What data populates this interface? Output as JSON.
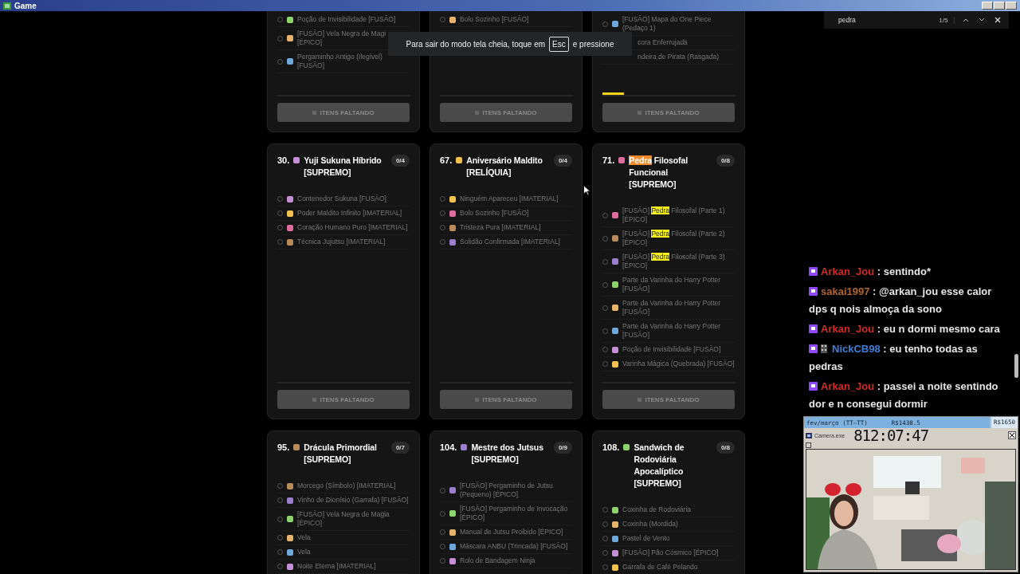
{
  "window": {
    "title": "Game"
  },
  "fullscreen_notice": {
    "before": "Para sair do modo tela cheia, toque em",
    "key": "Esc",
    "after": "e pressione"
  },
  "find_bar": {
    "value": "pedra",
    "count": "1/5"
  },
  "cards": [
    {
      "items": [
        {
          "text": "Poção de Invisibilidade [FUSÃO]",
          "checked": false
        },
        {
          "text": "[FUSÃO] Vela Negra de Magi [ÉPICO]",
          "checked": false
        },
        {
          "text": "Pergaminho Antigo (Ilegível) [FUSÃO]",
          "checked": false
        }
      ],
      "button": "ITENS FALTANDO"
    },
    {
      "items": [
        {
          "text": "Bolo Sozinho [FUSÃO]",
          "checked": false
        }
      ],
      "button": "ITENS FALTANDO"
    },
    {
      "items": [
        {
          "text": "[FUSÃO] Mapa do One Piece (Pedaço 1)",
          "checked": false
        },
        {
          "text": "cora Enferrujada",
          "kind": "partial"
        },
        {
          "text": "ndeira de Pirata (Rasgada)",
          "kind": "partial"
        }
      ],
      "level": 0.16,
      "button": "ITENS FALTANDO"
    },
    {
      "number": "30.",
      "title": [
        {
          "text": "Yuji Sukuna Híbrido [SUPREMO]",
          "highlighted": false,
          "current": false
        }
      ],
      "count": "0/4",
      "items": [
        {
          "text": "Contenedor Sukuna [FUSÃO]",
          "checked": false
        },
        {
          "text": "Poder Maldito Infinito [IMATERIAL]",
          "checked": false
        },
        {
          "text": "Coração Humano Puro [IMATERIAL]",
          "checked": false
        },
        {
          "text": "Técnica Jujutsu [IMATERIAL]",
          "checked": false
        }
      ],
      "button": "ITENS FALTANDO"
    },
    {
      "number": "67.",
      "title": [
        {
          "text": "Aniversário Maldito [RELÍQUIA]",
          "highlighted": false,
          "current": false
        }
      ],
      "count": "0/4",
      "items": [
        {
          "text": "Ninguém Apareceu [IMATERIAL]",
          "checked": false
        },
        {
          "text": "Bolo Sozinho [FUSÃO]",
          "checked": false
        },
        {
          "text": "Tristeza Pura [IMATERIAL]",
          "checked": false
        },
        {
          "text": "Solidão Confirmada [IMATERIAL]",
          "checked": false
        }
      ],
      "button": "ITENS FALTANDO"
    },
    {
      "number": "71.",
      "title": [
        {
          "text": "Pedra",
          "highlighted": true,
          "current": true
        },
        {
          "text": " Filosofal Funcional [SUPREMO]",
          "highlighted": false,
          "current": false
        }
      ],
      "count": "0/8",
      "items": [
        {
          "parts": [
            {
              "text": "[FUSÃO] ",
              "highlighted": false,
              "current": false
            },
            {
              "text": "Pedra",
              "highlighted": true,
              "current": false
            },
            {
              "text": " Filosofal (Parte 1) [ÉPICO]",
              "highlighted": false,
              "current": false
            }
          ],
          "checked": false
        },
        {
          "parts": [
            {
              "text": "[FUSÃO] ",
              "highlighted": false,
              "current": false
            },
            {
              "text": "Pedra",
              "highlighted": true,
              "current": false
            },
            {
              "text": " Filosofal (Parte 2) [ÉPICO]",
              "highlighted": false,
              "current": false
            }
          ],
          "checked": false
        },
        {
          "parts": [
            {
              "text": "[FUSÃO] ",
              "highlighted": false,
              "current": false
            },
            {
              "text": "Pedra",
              "highlighted": true,
              "current": false
            },
            {
              "text": " Filosofal (Parte 3) [ÉPICO]",
              "highlighted": false,
              "current": false
            }
          ],
          "checked": false
        },
        {
          "text": "Parte da Varinha do Harry Potter [FUSÃO]",
          "checked": false
        },
        {
          "text": "Parte da Varinha do Harry Potter [FUSÃO]",
          "checked": false
        },
        {
          "text": "Parte da Varinha do Harry Potter [FUSÃO]",
          "checked": false
        },
        {
          "text": "Poção de Invisibilidade [FUSÃO]",
          "checked": false
        },
        {
          "text": "Varinha Mágica (Quebrada) [FUSÃO]",
          "checked": false
        }
      ],
      "button": "ITENS FALTANDO"
    },
    {
      "number": "95.",
      "title": [
        {
          "text": "Drácula Primordial [SUPREMO]",
          "highlighted": false,
          "current": false
        }
      ],
      "count": "0/7",
      "items": [
        {
          "text": "Morcego (Símbolo) [IMATERIAL]",
          "checked": false
        },
        {
          "text": "Vinho de Dionísio (Garrafa) [FUSÃO]",
          "checked": false
        },
        {
          "text": "[FUSÃO] Vela Negra de Magia [ÉPICO]",
          "checked": false
        },
        {
          "text": "Vela",
          "checked": false
        },
        {
          "text": "Vela",
          "checked": false
        },
        {
          "text": "Noite Eterna [IMATERIAL]",
          "checked": false
        }
      ]
    },
    {
      "number": "104.",
      "title": [
        {
          "text": "Mestre dos Jutsus [SUPREMO]",
          "highlighted": false,
          "current": false
        }
      ],
      "count": "0/9",
      "items": [
        {
          "text": "[FUSÃO] Pergaminho de Jutsu (Pequeno) [ÉPICO]",
          "checked": false
        },
        {
          "text": "[FUSÃO] Pergaminho de Invocação [ÉPICO]",
          "checked": false
        },
        {
          "text": "Manual de Jutsu Proibido [ÉPICO]",
          "checked": false
        },
        {
          "text": "Máscara ANBU (Trincada) [FUSÃO]",
          "checked": false
        },
        {
          "text": "Rolo de Bandagem Ninja",
          "checked": false
        }
      ]
    },
    {
      "number": "108.",
      "title": [
        {
          "text": "Sandwich de Rodoviária Apocalíptico [SUPREMO]",
          "highlighted": false,
          "current": false
        }
      ],
      "count": "0/8",
      "items": [
        {
          "text": "Coxinha de Rodoviária",
          "checked": false
        },
        {
          "text": "Coxinha (Mordida)",
          "checked": false
        },
        {
          "text": "Pastel de Vento",
          "checked": false
        },
        {
          "text": "[FUSÃO] Pão Cósmico [ÉPICO]",
          "checked": false
        },
        {
          "text": "Garrafa de Café Pelando",
          "checked": false
        }
      ]
    }
  ],
  "chat": [
    {
      "user": "Arkan_Jou",
      "color": "#d42a22",
      "text": ": sentindo*",
      "kind": "plain"
    },
    {
      "user": "sakai1997",
      "color": "#b0652c",
      "text": ": @arkan_jou esse calor dps q nois almoça da sono",
      "kind": "plain"
    },
    {
      "user": "Arkan_Jou",
      "color": "#d42a22",
      "text": ": eu n dormi mesmo cara",
      "kind": "plain"
    },
    {
      "user": "NickCB98",
      "color": "#3d7fd6",
      "text": ": eu tenho todas as pedras",
      "kind": "badged"
    },
    {
      "user": "Arkan_Jou",
      "color": "#d42a22",
      "text": ": passei a noite sentindo dor e n consegui dormir",
      "kind": "plain"
    }
  ],
  "goal": {
    "label": "fev/março (TT—TT)",
    "current": "R$1438.5",
    "target": "R$1650",
    "level": 0.87
  },
  "camera": {
    "title": "Camera.exe",
    "timer": "812:07:47",
    "kind": "picture"
  }
}
